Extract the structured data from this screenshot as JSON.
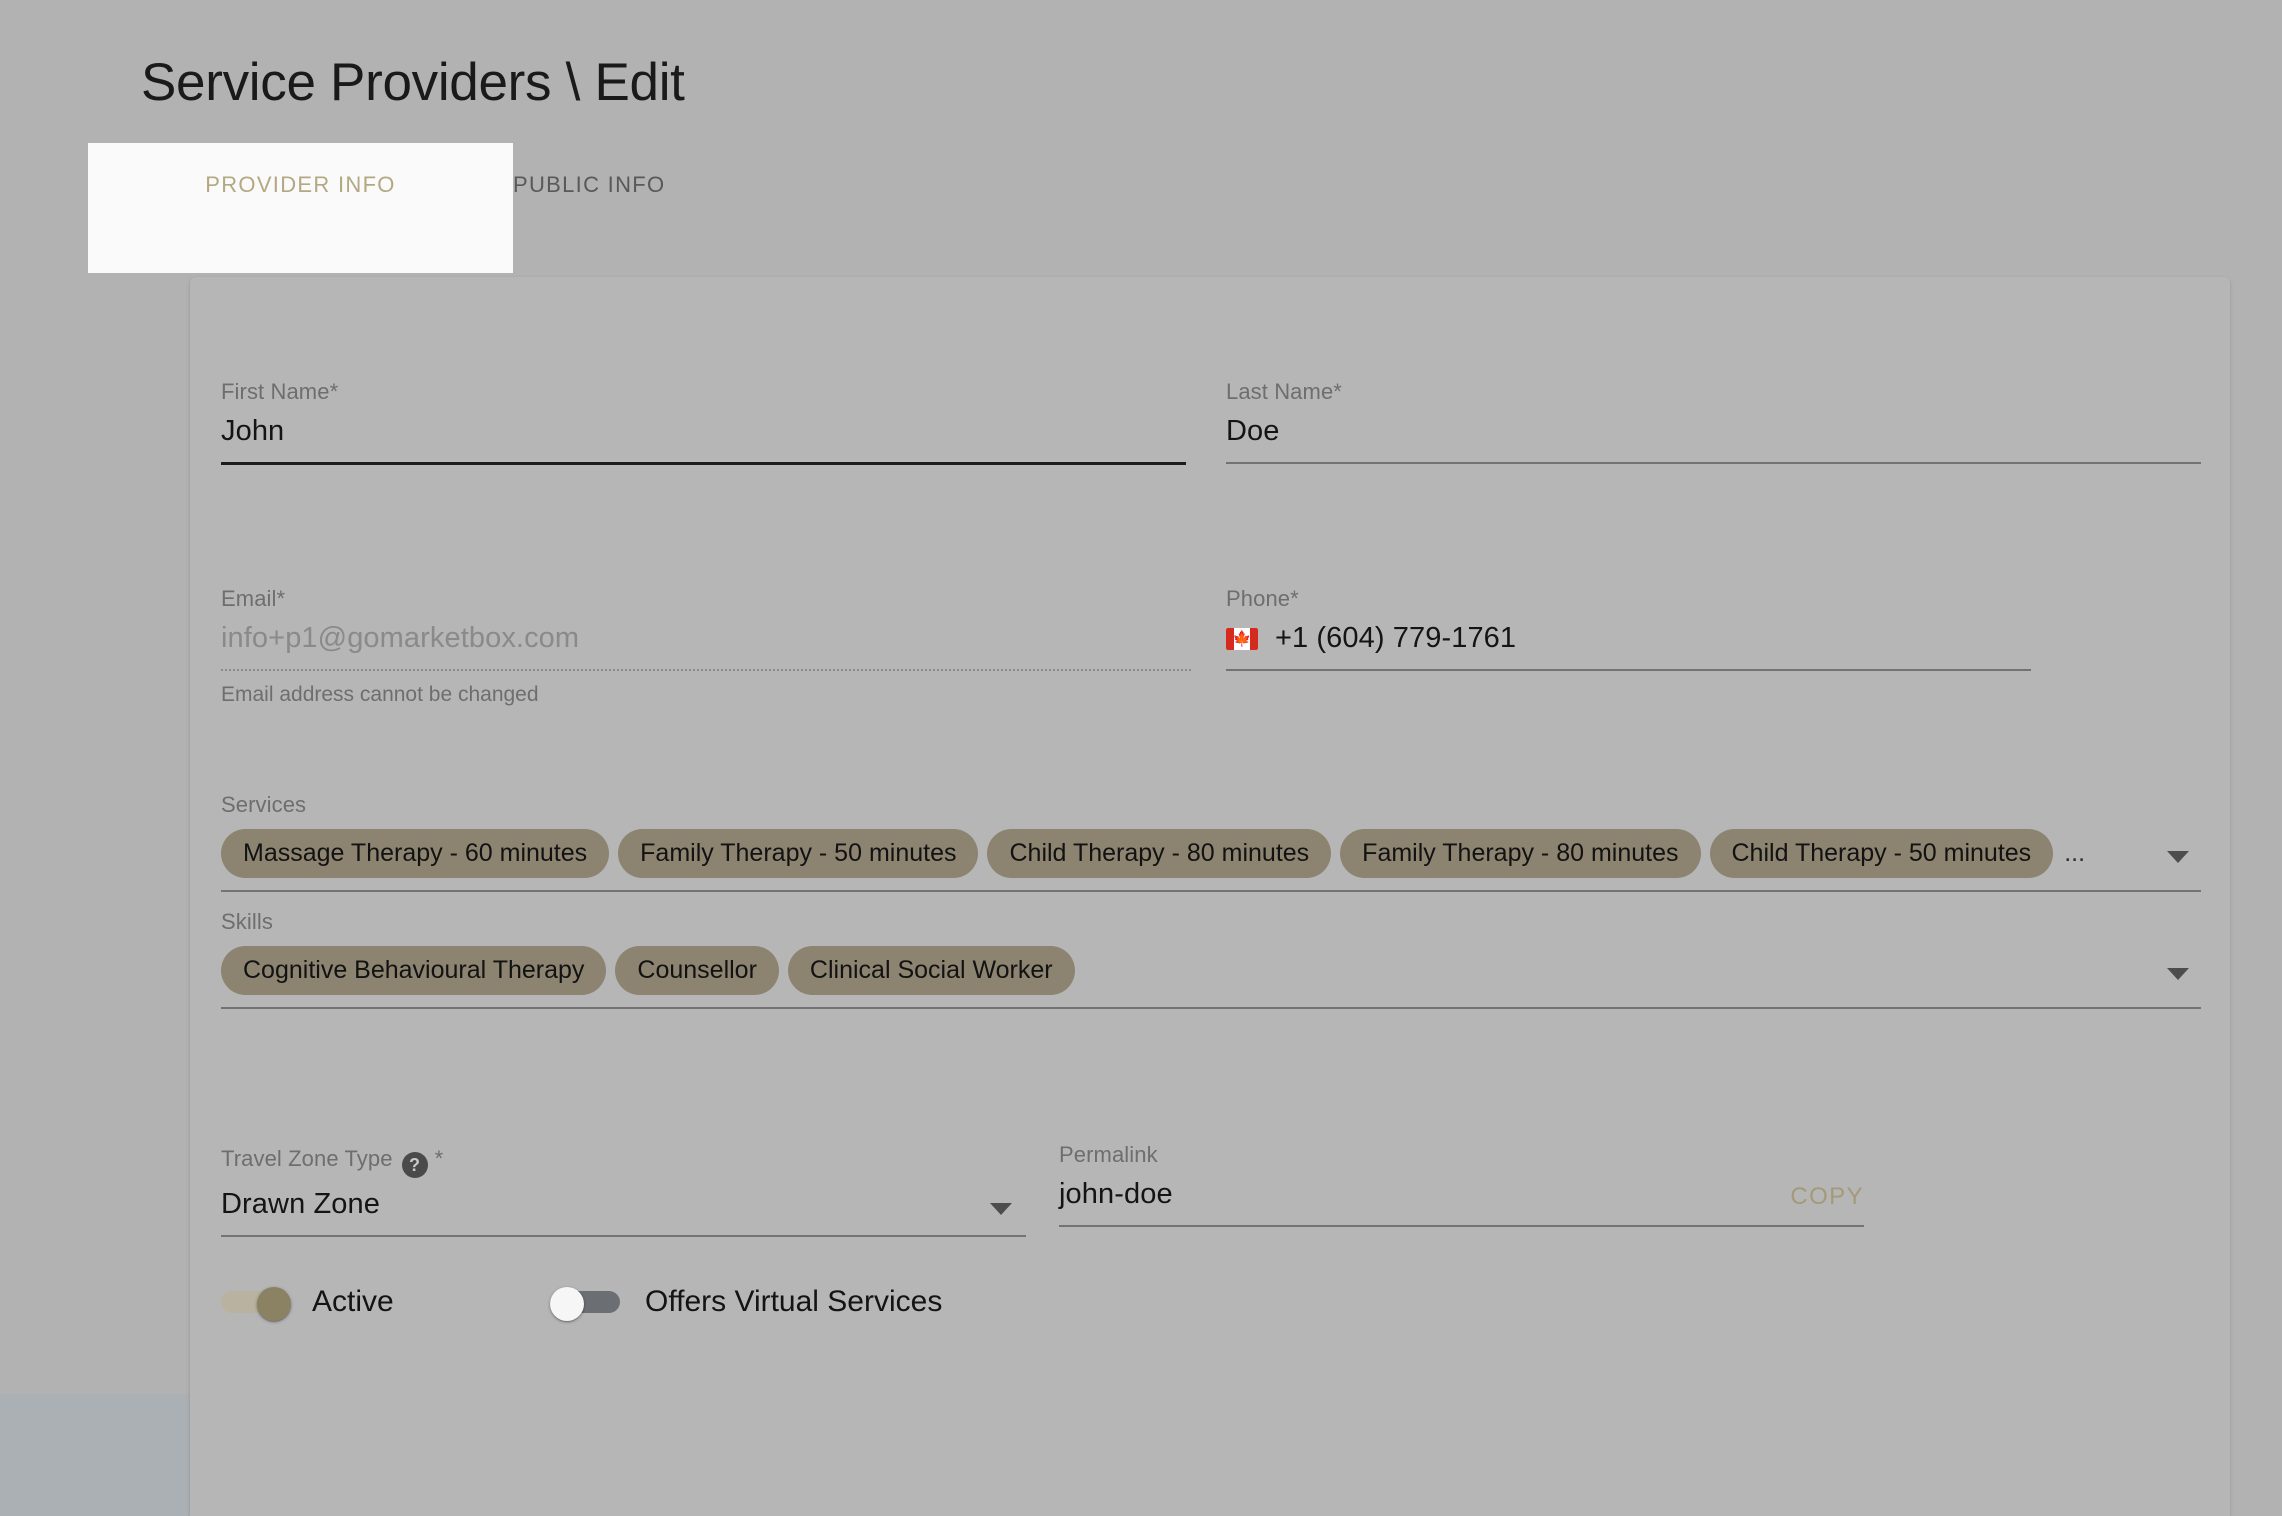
{
  "page": {
    "title": "Service Providers \\ Edit",
    "accent_color": "#b3a882",
    "chip_color": "#8c8470",
    "background_color": "#b2b2b2",
    "card_color": "#b6b6b6"
  },
  "tabs": [
    {
      "label": "PROVIDER INFO",
      "active": true
    },
    {
      "label": "PUBLIC INFO",
      "active": false
    }
  ],
  "form": {
    "first_name": {
      "label": "First Name",
      "required_marker": "*",
      "value": "John",
      "placeholder": "First Name"
    },
    "last_name": {
      "label": "Last Name",
      "required_marker": "*",
      "value": "Doe",
      "placeholder": "Last Name"
    },
    "email": {
      "label": "Email",
      "required_marker": "*",
      "value": "info+p1@gomarketbox.com",
      "hint": "Email address cannot be changed"
    },
    "phone": {
      "label": "Phone",
      "required_marker": "*",
      "country_flag": "canada-flag-icon",
      "value": "+1 (604) 779-1761"
    },
    "services": {
      "label": "Services",
      "chips": [
        "Massage Therapy - 60 minutes",
        "Family Therapy - 50 minutes",
        "Child Therapy - 80 minutes",
        "Family Therapy - 80 minutes",
        "Child Therapy - 50 minutes"
      ],
      "overflow_indicator": "...",
      "dropdown_icon": "chevron-down-icon"
    },
    "skills": {
      "label": "Skills",
      "chips": [
        "Cognitive Behavioural Therapy",
        "Counsellor",
        "Clinical Social Worker"
      ],
      "dropdown_icon": "chevron-down-icon"
    },
    "travel_zone_type": {
      "label": "Travel Zone Type",
      "required_marker": "*",
      "help_icon": "question-mark-icon",
      "help_glyph": "?",
      "value": "Drawn Zone",
      "dropdown_icon": "chevron-down-icon"
    },
    "permalink": {
      "label": "Permalink",
      "value": "john-doe",
      "copy_label": "COPY"
    },
    "toggles": [
      {
        "label": "Active",
        "state": "on"
      },
      {
        "label": "Offers Virtual Services",
        "state": "off"
      }
    ]
  }
}
